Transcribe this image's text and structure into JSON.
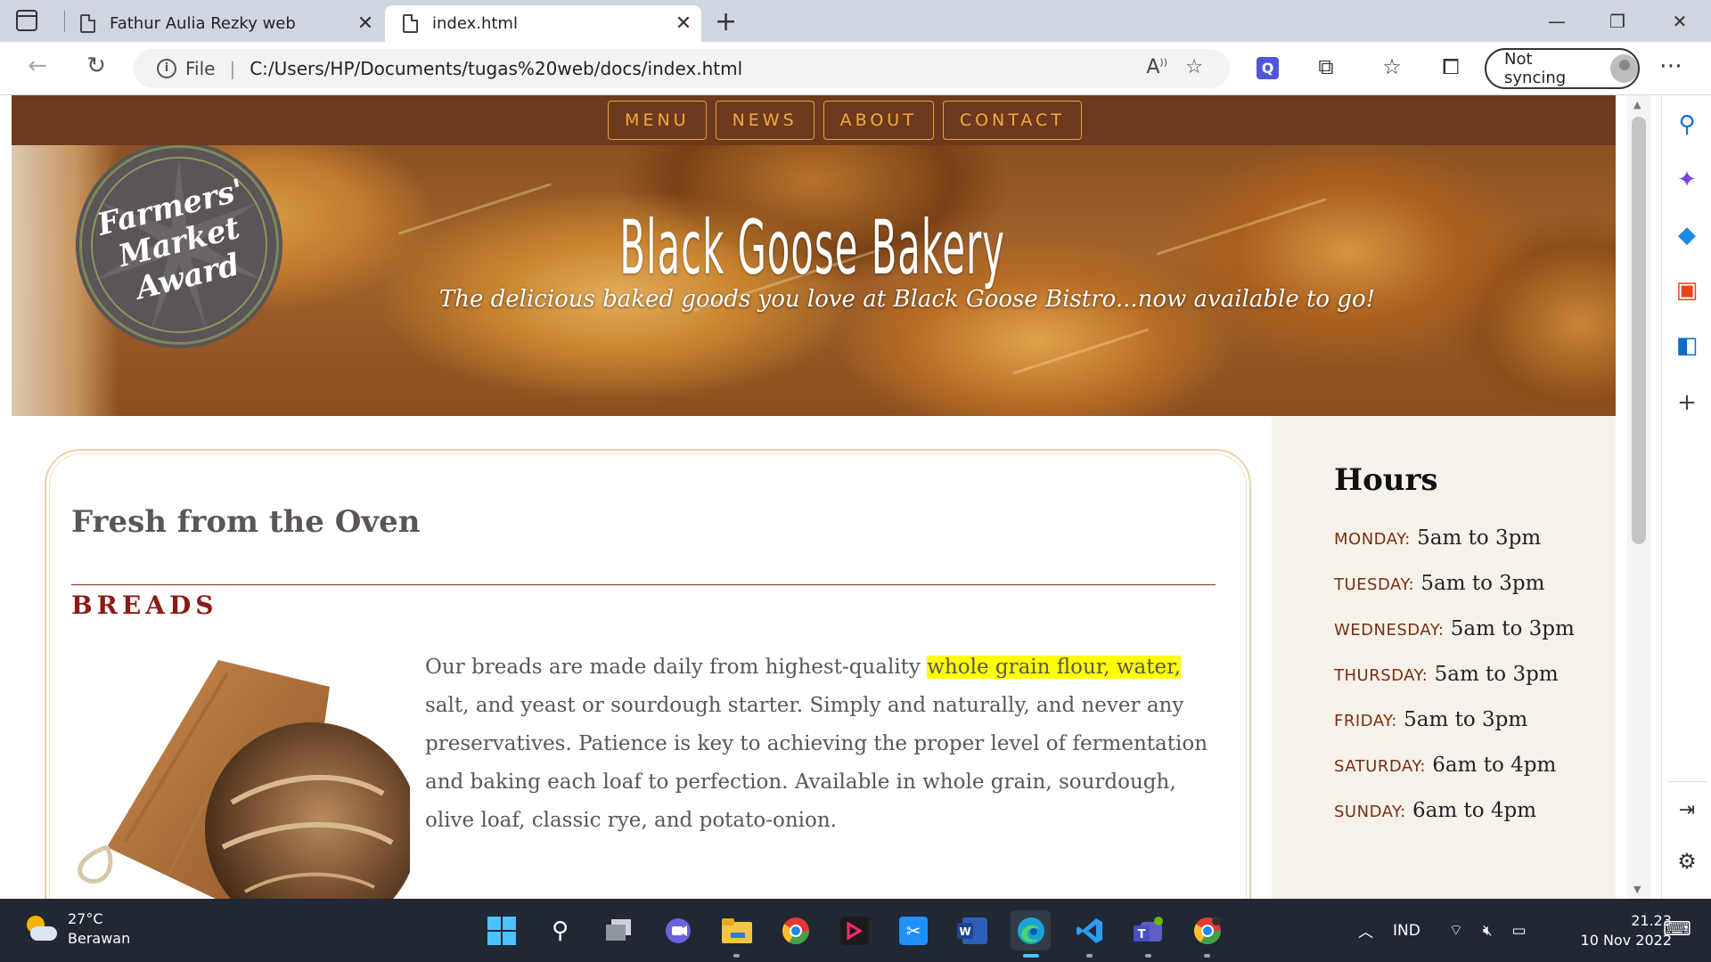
{
  "browser": {
    "tabs": [
      {
        "title": "Fathur Aulia Rezky web",
        "active": false
      },
      {
        "title": "index.html",
        "active": true
      }
    ],
    "new_tab_icon": "+",
    "window_controls": [
      "minimize",
      "restore",
      "close"
    ],
    "address": {
      "scheme_label": "File",
      "url": "C:/Users/HP/Documents/tugas%20web/docs/index.html"
    },
    "sync_label": "Not syncing",
    "accent_color": "#4f55d8"
  },
  "site": {
    "nav": [
      "MENU",
      "NEWS",
      "ABOUT",
      "CONTACT"
    ],
    "badge": {
      "line1": "Farmers'",
      "line2": "Market",
      "line3": "Award"
    },
    "title": "Black Goose Bakery",
    "tagline": "The delicious baked goods you love at Black Goose Bistro...now available to go!",
    "main": {
      "heading": "Fresh from the Oven",
      "section_title": "BREADS",
      "paragraph_before": "Our breads are made daily from highest-quality ",
      "paragraph_highlight": "whole grain flour, water,",
      "paragraph_after": " salt, and yeast or sourdough starter. Simply and naturally, and never any preservatives. Patience is key to achieving the proper level of fermentation and baking each loaf to perfection. Available in whole grain, sourdough, olive loaf, classic rye, and potato-onion."
    },
    "hours": {
      "heading": "Hours",
      "items": [
        {
          "day": "MONDAY:",
          "time": "5am to 3pm"
        },
        {
          "day": "TUESDAY:",
          "time": "5am to 3pm"
        },
        {
          "day": "WEDNESDAY:",
          "time": "5am to 3pm"
        },
        {
          "day": "THURSDAY:",
          "time": "5am to 3pm"
        },
        {
          "day": "FRIDAY:",
          "time": "5am to 3pm"
        },
        {
          "day": "SATURDAY:",
          "time": "6am to 4pm"
        },
        {
          "day": "SUNDAY:",
          "time": "6am to 4pm"
        }
      ]
    },
    "colors": {
      "nav_bg": "#6e3a1e",
      "nav_text": "#f0a93f",
      "accent_red": "#8c1c13",
      "highlight": "#ffff00",
      "aside_bg": "#f6f2ea"
    }
  },
  "taskbar": {
    "weather_temp": "27°C",
    "weather_desc": "Berawan",
    "language": "IND",
    "time": "21.23",
    "date": "10 Nov 2022",
    "apps": [
      "start",
      "search",
      "task-view",
      "chat",
      "file-explorer",
      "chrome",
      "app-red",
      "capcut",
      "word",
      "edge",
      "vscode",
      "teams",
      "chrome-profile"
    ]
  }
}
